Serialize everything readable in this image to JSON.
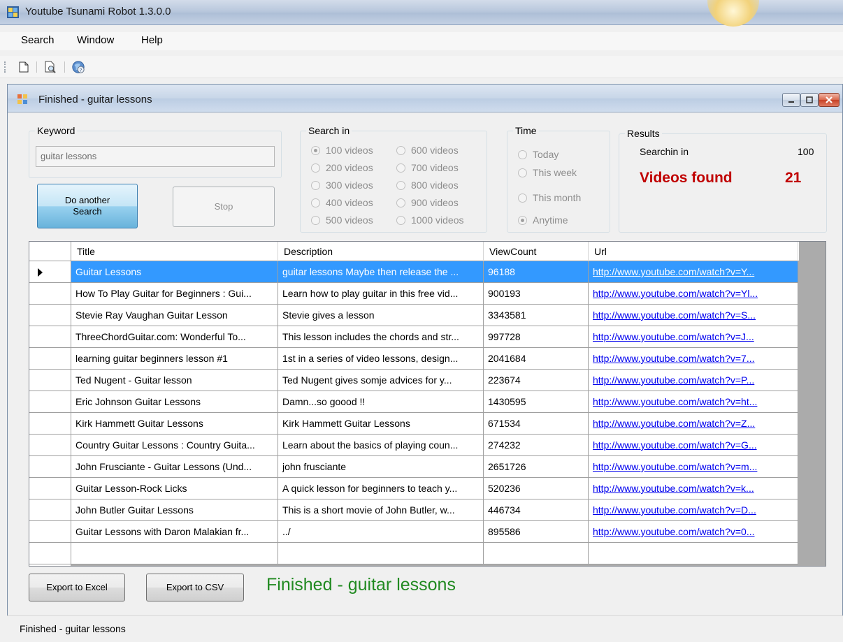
{
  "app": {
    "title": "Youtube Tsunami Robot 1.3.0.0"
  },
  "menu": {
    "items": [
      "Search",
      "Window",
      "Help"
    ]
  },
  "toolbar": {
    "icons": [
      "new-document-icon",
      "print-preview-icon",
      "help-globe-icon"
    ]
  },
  "child_window": {
    "title": "Finished - guitar lessons"
  },
  "keyword": {
    "label": "Keyword",
    "value": "guitar lessons"
  },
  "buttons": {
    "do_another_search": "Do another\nSearch",
    "stop": "Stop",
    "export_excel": "Export to Excel",
    "export_csv": "Export to CSV"
  },
  "search_in": {
    "label": "Search in",
    "options": [
      "100 videos",
      "200 videos",
      "300 videos",
      "400 videos",
      "500 videos",
      "600 videos",
      "700 videos",
      "800 videos",
      "900 videos",
      "1000 videos"
    ],
    "selected": "100 videos"
  },
  "time": {
    "label": "Time",
    "options": [
      "Today",
      "This week",
      "This month",
      "Anytime"
    ],
    "selected": "Anytime"
  },
  "results": {
    "label": "Results",
    "searching_label": "Searchin in",
    "searching_value": "100",
    "found_label": "Videos found",
    "found_value": "21"
  },
  "grid": {
    "columns": [
      "Title",
      "Description",
      "ViewCount",
      "Url"
    ],
    "rows": [
      [
        "Guitar Lessons",
        "guitar lessons Maybe then release the ...",
        "96188",
        "http://www.youtube.com/watch?v=Y..."
      ],
      [
        "How To Play Guitar for Beginners : Gui...",
        "Learn how to play guitar in this free vid...",
        "900193",
        "http://www.youtube.com/watch?v=Yl..."
      ],
      [
        "Stevie Ray Vaughan Guitar Lesson",
        "Stevie gives a lesson",
        "3343581",
        "http://www.youtube.com/watch?v=S..."
      ],
      [
        "ThreeChordGuitar.com: Wonderful To...",
        "This lesson includes the chords and str...",
        "997728",
        "http://www.youtube.com/watch?v=J..."
      ],
      [
        "learning guitar beginners lesson #1",
        "1st in a series of video lessons, design...",
        "2041684",
        "http://www.youtube.com/watch?v=7..."
      ],
      [
        "Ted Nugent - Guitar lesson",
        "Ted Nugent gives somje advices for y...",
        "223674",
        "http://www.youtube.com/watch?v=P..."
      ],
      [
        "Eric Johnson Guitar Lessons",
        "Damn...so goood !!",
        "1430595",
        "http://www.youtube.com/watch?v=ht..."
      ],
      [
        "Kirk Hammett Guitar Lessons",
        "Kirk Hammett Guitar Lessons",
        "671534",
        "http://www.youtube.com/watch?v=Z..."
      ],
      [
        "Country Guitar Lessons : Country Guita...",
        "Learn about the basics of playing coun...",
        "274232",
        "http://www.youtube.com/watch?v=G..."
      ],
      [
        "John Frusciante - Guitar Lessons (Und...",
        "john frusciante",
        "2651726",
        "http://www.youtube.com/watch?v=m..."
      ],
      [
        "Guitar Lesson-Rock Licks",
        "A quick lesson for beginners to teach y...",
        "520236",
        "http://www.youtube.com/watch?v=k..."
      ],
      [
        "John Butler Guitar Lessons",
        "This is a short movie of John Butler, w...",
        "446734",
        "http://www.youtube.com/watch?v=D..."
      ],
      [
        "Guitar Lessons with Daron Malakian fr...",
        "../",
        "895586",
        "http://www.youtube.com/watch?v=0..."
      ]
    ],
    "selected_row": 0
  },
  "status": {
    "big": "Finished - guitar lessons",
    "bar": "Finished - guitar lessons"
  },
  "colors": {
    "selection": "#3399ff",
    "found": "#c00000",
    "finished": "#218a21",
    "link": "#0000ee"
  }
}
